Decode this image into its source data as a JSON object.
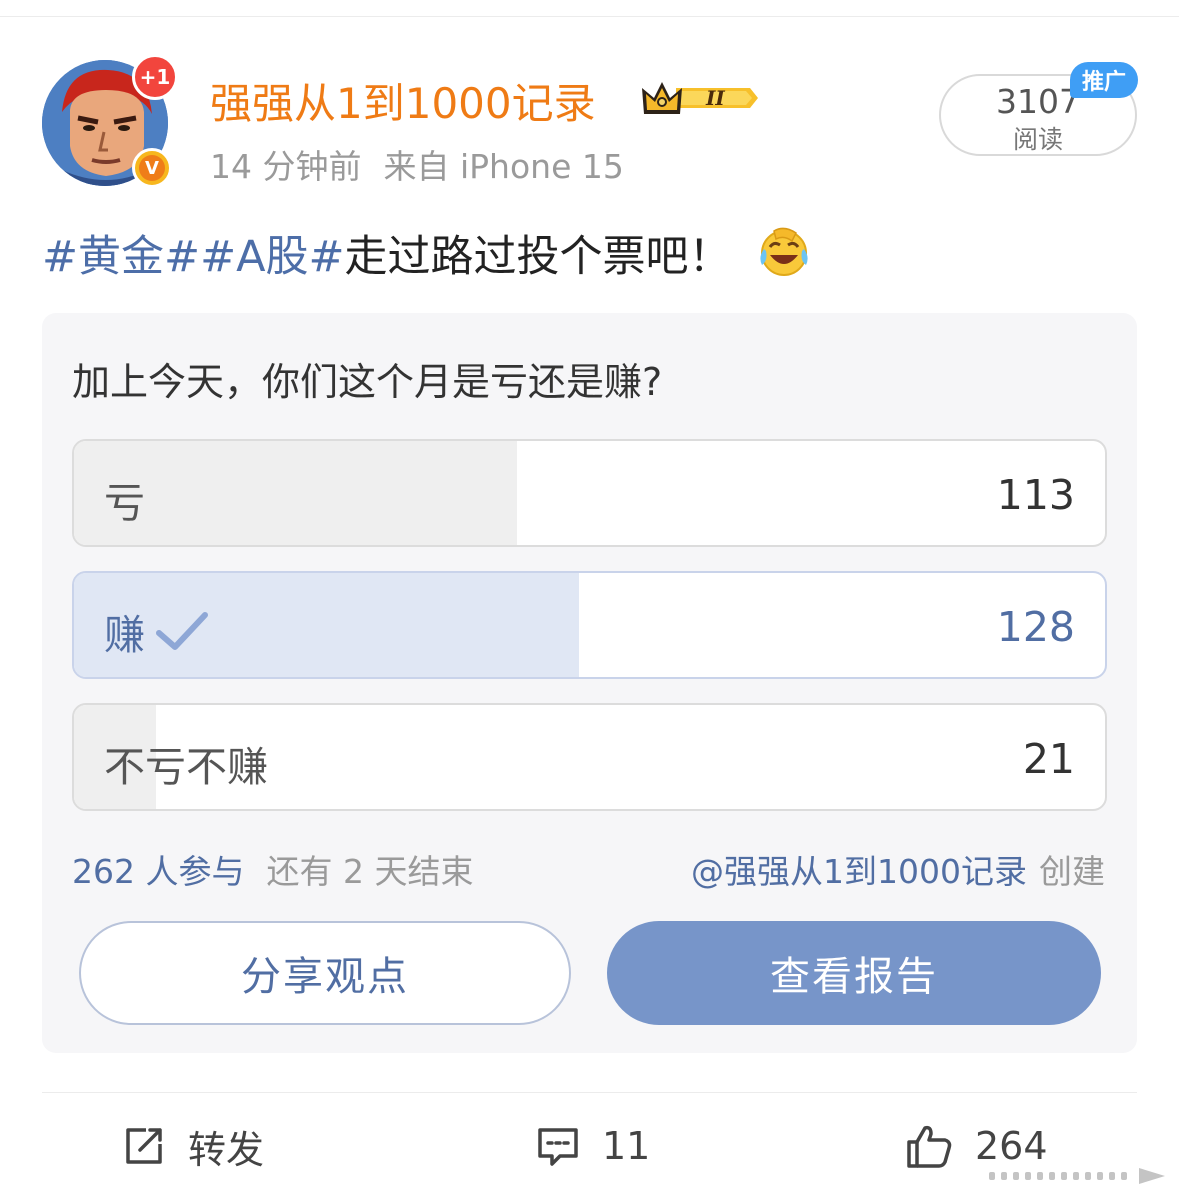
{
  "header": {
    "plus_badge": "+1",
    "verified_mark": "V",
    "username": "强强从1到1000记录",
    "member_level": "II",
    "time_ago": "14 分钟前",
    "source": "来自 iPhone 15",
    "read_count": "3107",
    "read_label": "阅读",
    "promo_tag": "推广"
  },
  "post": {
    "hashtag_1": "#黄金#",
    "hashtag_2": "#A股#",
    "text": "走过路过投个票吧！",
    "emoji": "laughing-crying-icon"
  },
  "poll": {
    "question": "加上今天，你们这个月是亏还是赚?",
    "options": [
      {
        "label": "亏",
        "count": "113",
        "share": 0.43,
        "selected": false
      },
      {
        "label": "赚",
        "count": "128",
        "share": 0.49,
        "selected": true
      },
      {
        "label": "不亏不赚",
        "count": "21",
        "share": 0.08,
        "selected": false
      }
    ],
    "participants": "262 人参与",
    "remaining": "还有 2 天结束",
    "creator": "@强强从1到1000记录",
    "created_label": "创建",
    "share_button": "分享观点",
    "report_button": "查看报告"
  },
  "actions": {
    "repost_label": "转发",
    "comment_count": "11",
    "like_count": "264"
  },
  "colors": {
    "username": "#ef7b15",
    "link_blue": "#516ea3",
    "primary_button": "#7795c9",
    "promo": "#3f9ef5"
  }
}
